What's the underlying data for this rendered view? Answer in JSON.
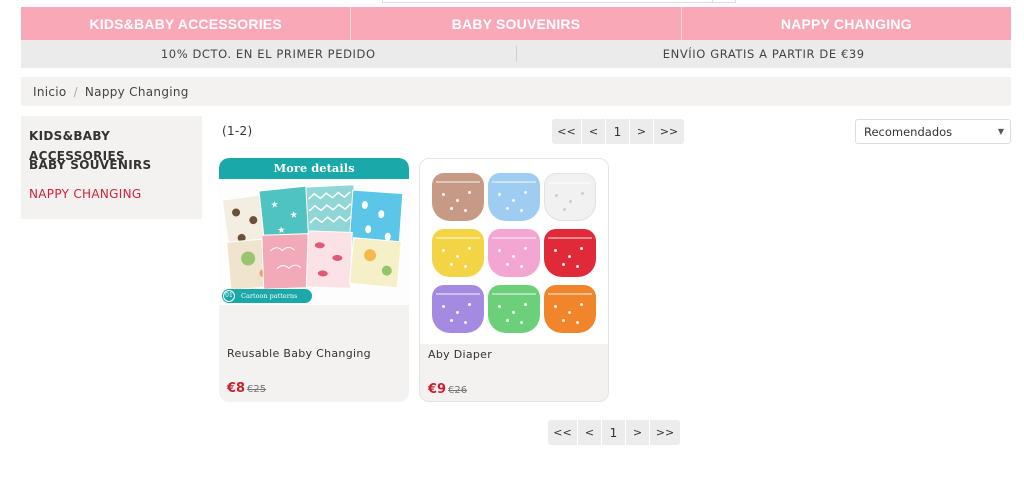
{
  "nav": {
    "items": [
      "KIDS&BABY ACCESSORIES",
      "BABY SOUVENIRS",
      "NAPPY CHANGING"
    ]
  },
  "promo": {
    "left": "10% DCTO. EN EL PRIMER PEDIDO",
    "right": "ENVÍIO GRATIS A PARTIR DE €39"
  },
  "breadcrumb": {
    "home": "Inicio",
    "separator": "/",
    "current": "Nappy Changing"
  },
  "sidebar": {
    "categories": [
      {
        "label": "KIDS&BABY ACCESSORIES",
        "active": false
      },
      {
        "label": "BABY SOUVENIRS",
        "active": false
      },
      {
        "label": "NAPPY CHANGING",
        "active": true
      }
    ]
  },
  "results": {
    "count": "(1-2)"
  },
  "pagination": {
    "first": "<<",
    "prev": "<",
    "current_page": "1",
    "next": ">",
    "last": ">>"
  },
  "sort": {
    "selected": "Recomendados",
    "icon": "chevron-down-icon"
  },
  "products": [
    {
      "name": "Reusable Baby Changing",
      "price": "€8",
      "old_price": "€25",
      "image": {
        "banner_text": "More details",
        "tag_number": "01",
        "tag_text": "Cartoon patterns"
      }
    },
    {
      "name": "Aby Diaper",
      "price": "€9",
      "old_price": "€26"
    }
  ],
  "colors": {
    "nav_bg": "#f9a8b8",
    "accent_red": "#d1213a",
    "price_red": "#c8202f",
    "panel_bg": "#f3f2f1",
    "teal": "#1aa9a8"
  }
}
